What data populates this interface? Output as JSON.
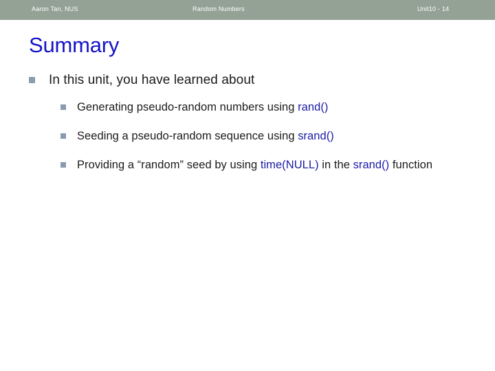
{
  "header": {
    "left": "Aaron Tan, NUS",
    "center": "Random Numbers",
    "right": "Unit10 - 14",
    "background_color": "#94a295",
    "text_color": "#ffffff"
  },
  "title": {
    "text": "Summary",
    "color": "#1414c8"
  },
  "bullet_color": "#8a9ab0",
  "code_color": "#1a1aa8",
  "body": {
    "lead": "In this unit, you have learned about",
    "items": [
      {
        "pre": "Generating pseudo-random numbers using ",
        "code": "rand()",
        "post": ""
      },
      {
        "pre": "Seeding a pseudo-random sequence using ",
        "code": "srand()",
        "post": ""
      },
      {
        "pre": "Providing a “random” seed by using ",
        "code": "time(NULL)",
        "mid": " in the ",
        "code2": "srand()",
        "post": " function"
      }
    ]
  }
}
